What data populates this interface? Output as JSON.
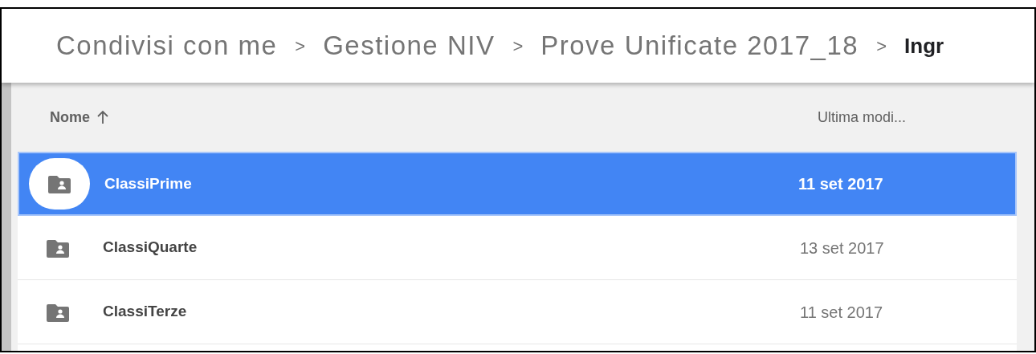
{
  "breadcrumb": [
    {
      "label": "Condivisi con me",
      "current": false
    },
    {
      "label": "Gestione NIV",
      "current": false
    },
    {
      "label": "Prove Unificate 2017_18",
      "current": false
    },
    {
      "label": "Ingr",
      "current": true
    }
  ],
  "breadcrumb_separator": ">",
  "table": {
    "columns": [
      {
        "label": "Nome",
        "sorted": true
      },
      {
        "label": "Ultima modi..."
      }
    ],
    "rows": [
      {
        "name": "ClassiPrime",
        "modified": "11 set 2017",
        "selected": true
      },
      {
        "name": "ClassiQuarte",
        "modified": "13 set 2017",
        "selected": false
      },
      {
        "name": "ClassiTerze",
        "modified": "11 set 2017",
        "selected": false
      }
    ]
  }
}
